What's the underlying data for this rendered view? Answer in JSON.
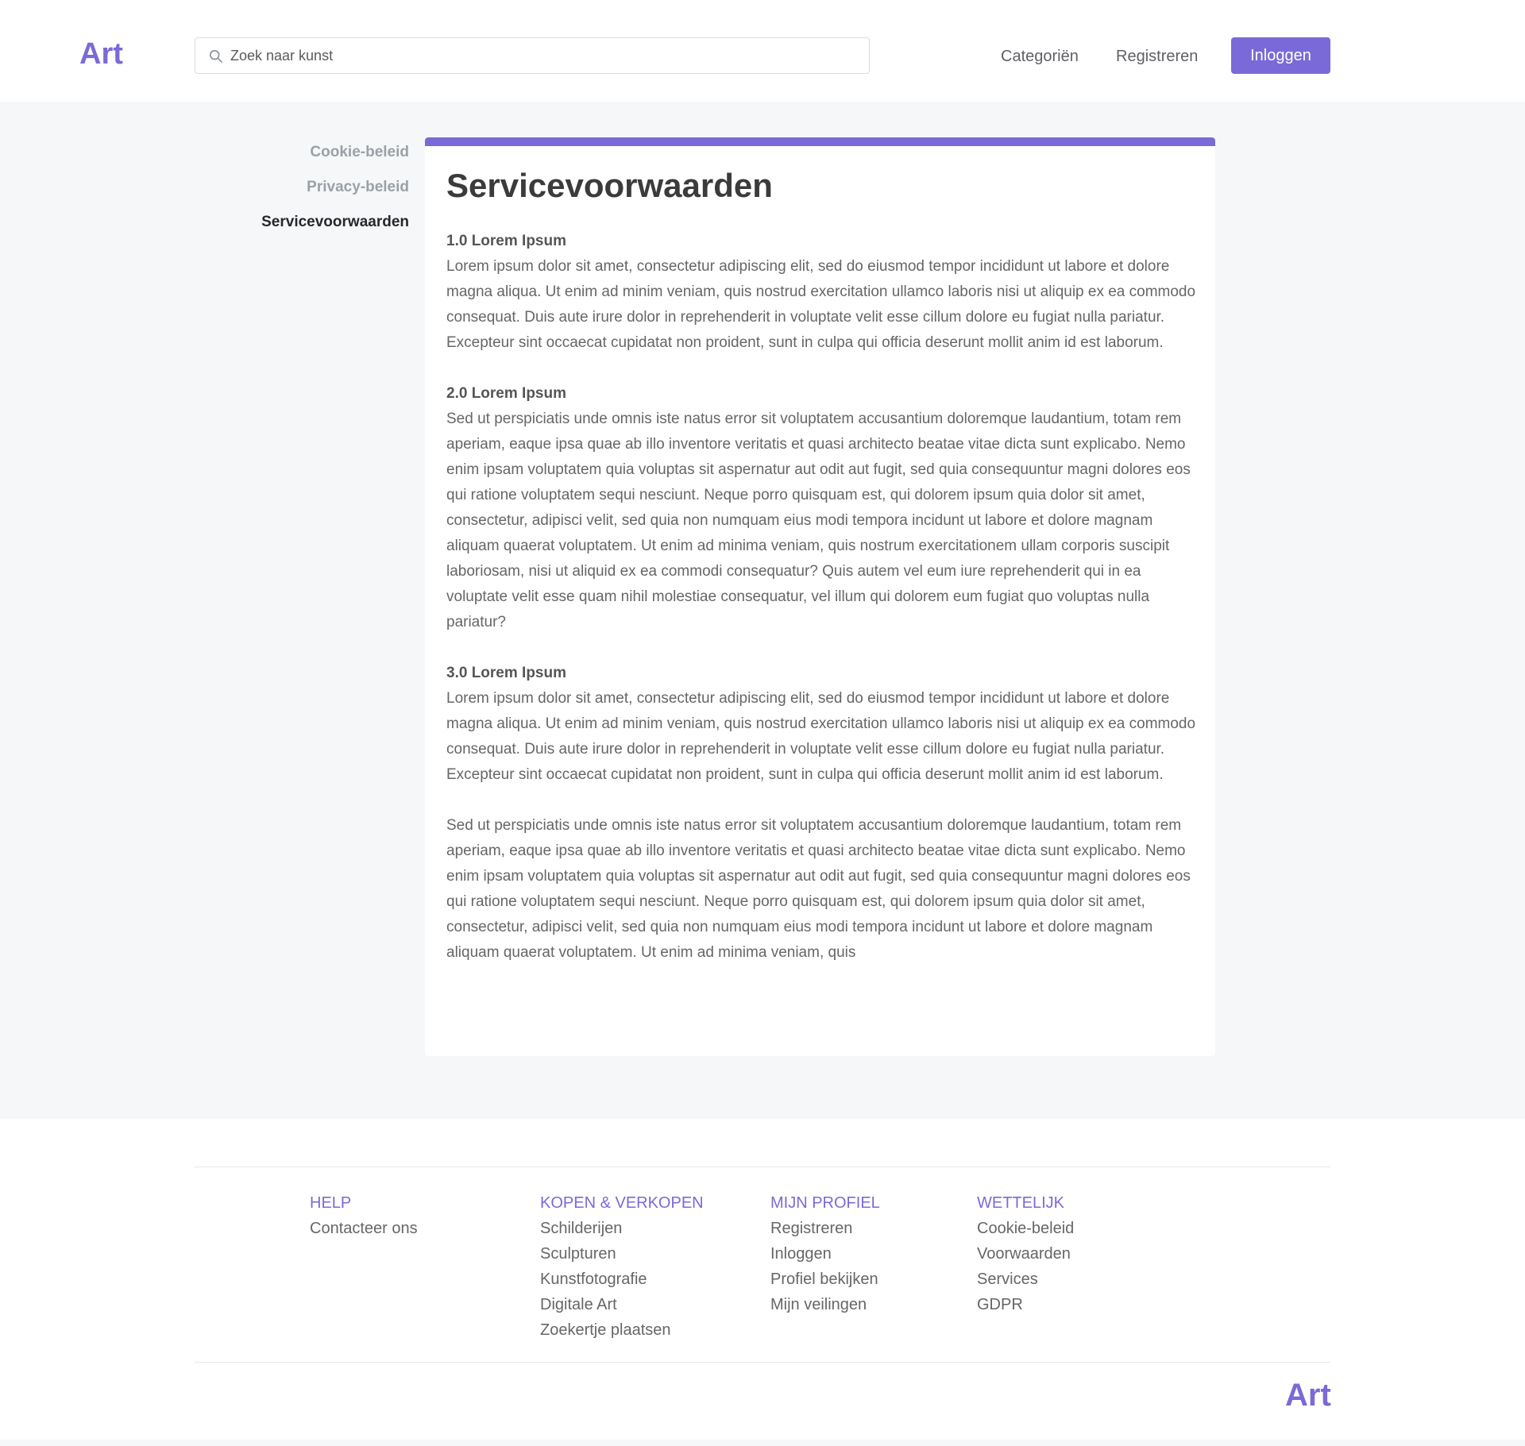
{
  "brand": {
    "logo": "Art",
    "accent_color": "#7a6ad8"
  },
  "header": {
    "search": {
      "placeholder": "Zoek naar kunst",
      "icon": "search-icon"
    },
    "nav": {
      "categories": "Categoriën",
      "register": "Registreren",
      "login": "Inloggen"
    }
  },
  "sidebar": {
    "items": [
      {
        "label": "Cookie-beleid"
      },
      {
        "label": "Privacy-beleid"
      },
      {
        "label": "Servicevoorwaarden",
        "active": true
      }
    ]
  },
  "content": {
    "title": "Servicevoorwaarden",
    "sections": [
      {
        "heading": "1.0 Lorem Ipsum",
        "text": "Lorem ipsum dolor sit amet, consectetur adipiscing elit, sed do eiusmod tempor incididunt ut labore et dolore magna aliqua. Ut enim ad minim veniam, quis nostrud exercitation ullamco laboris nisi ut aliquip ex ea commodo consequat. Duis aute irure dolor in reprehenderit in voluptate velit esse cillum dolore eu fugiat nulla pariatur. Excepteur sint occaecat cupidatat non proident, sunt in culpa qui officia deserunt mollit anim id est laborum."
      },
      {
        "heading": "2.0 Lorem Ipsum",
        "text": "Sed ut perspiciatis unde omnis iste natus error sit voluptatem accusantium doloremque laudantium, totam rem aperiam, eaque ipsa quae ab illo inventore veritatis et quasi architecto beatae vitae dicta sunt explicabo. Nemo enim ipsam voluptatem quia voluptas sit aspernatur aut odit aut fugit, sed quia consequuntur magni dolores eos qui ratione voluptatem sequi nesciunt. Neque porro quisquam est, qui dolorem ipsum quia dolor sit amet, consectetur, adipisci velit, sed quia non numquam eius modi tempora incidunt ut labore et dolore magnam aliquam quaerat voluptatem. Ut enim ad minima veniam, quis nostrum exercitationem ullam corporis suscipit laboriosam, nisi ut aliquid ex ea commodi consequatur? Quis autem vel eum iure reprehenderit qui in ea voluptate velit esse quam nihil molestiae consequatur, vel illum qui dolorem eum fugiat quo voluptas nulla pariatur?"
      },
      {
        "heading": "3.0 Lorem Ipsum",
        "text": "Lorem ipsum dolor sit amet, consectetur adipiscing elit, sed do eiusmod tempor incididunt ut labore et dolore magna aliqua. Ut enim ad minim veniam, quis nostrud exercitation ullamco laboris nisi ut aliquip ex ea commodo consequat. Duis aute irure dolor in reprehenderit in voluptate velit esse cillum dolore eu fugiat nulla pariatur. Excepteur sint occaecat cupidatat non proident, sunt in culpa qui officia deserunt mollit anim id est laborum."
      },
      {
        "heading": "",
        "text": "Sed ut perspiciatis unde omnis iste natus error sit voluptatem accusantium doloremque laudantium, totam rem aperiam, eaque ipsa quae ab illo inventore veritatis et quasi architecto beatae vitae dicta sunt explicabo. Nemo enim ipsam voluptatem quia voluptas sit aspernatur aut odit aut fugit, sed quia consequuntur magni dolores eos qui ratione voluptatem sequi nesciunt. Neque porro quisquam est, qui dolorem ipsum quia dolor sit amet, consectetur, adipisci velit, sed quia non numquam eius modi tempora incidunt ut labore et dolore magnam aliquam quaerat voluptatem. Ut enim ad minima veniam, quis"
      }
    ]
  },
  "footer": {
    "columns": [
      {
        "heading": "HELP",
        "links": [
          "Contacteer ons"
        ]
      },
      {
        "heading": "KOPEN & VERKOPEN",
        "links": [
          "Schilderijen",
          "Sculpturen",
          "Kunstfotografie",
          "Digitale Art",
          "Zoekertje plaatsen"
        ]
      },
      {
        "heading": "MIJN PROFIEL",
        "links": [
          "Registreren",
          "Inloggen",
          "Profiel bekijken",
          "Mijn veilingen"
        ]
      },
      {
        "heading": "WETTELIJK",
        "links": [
          "Cookie-beleid",
          "Voorwaarden",
          "Services",
          "GDPR"
        ]
      }
    ],
    "logo": "Art"
  }
}
